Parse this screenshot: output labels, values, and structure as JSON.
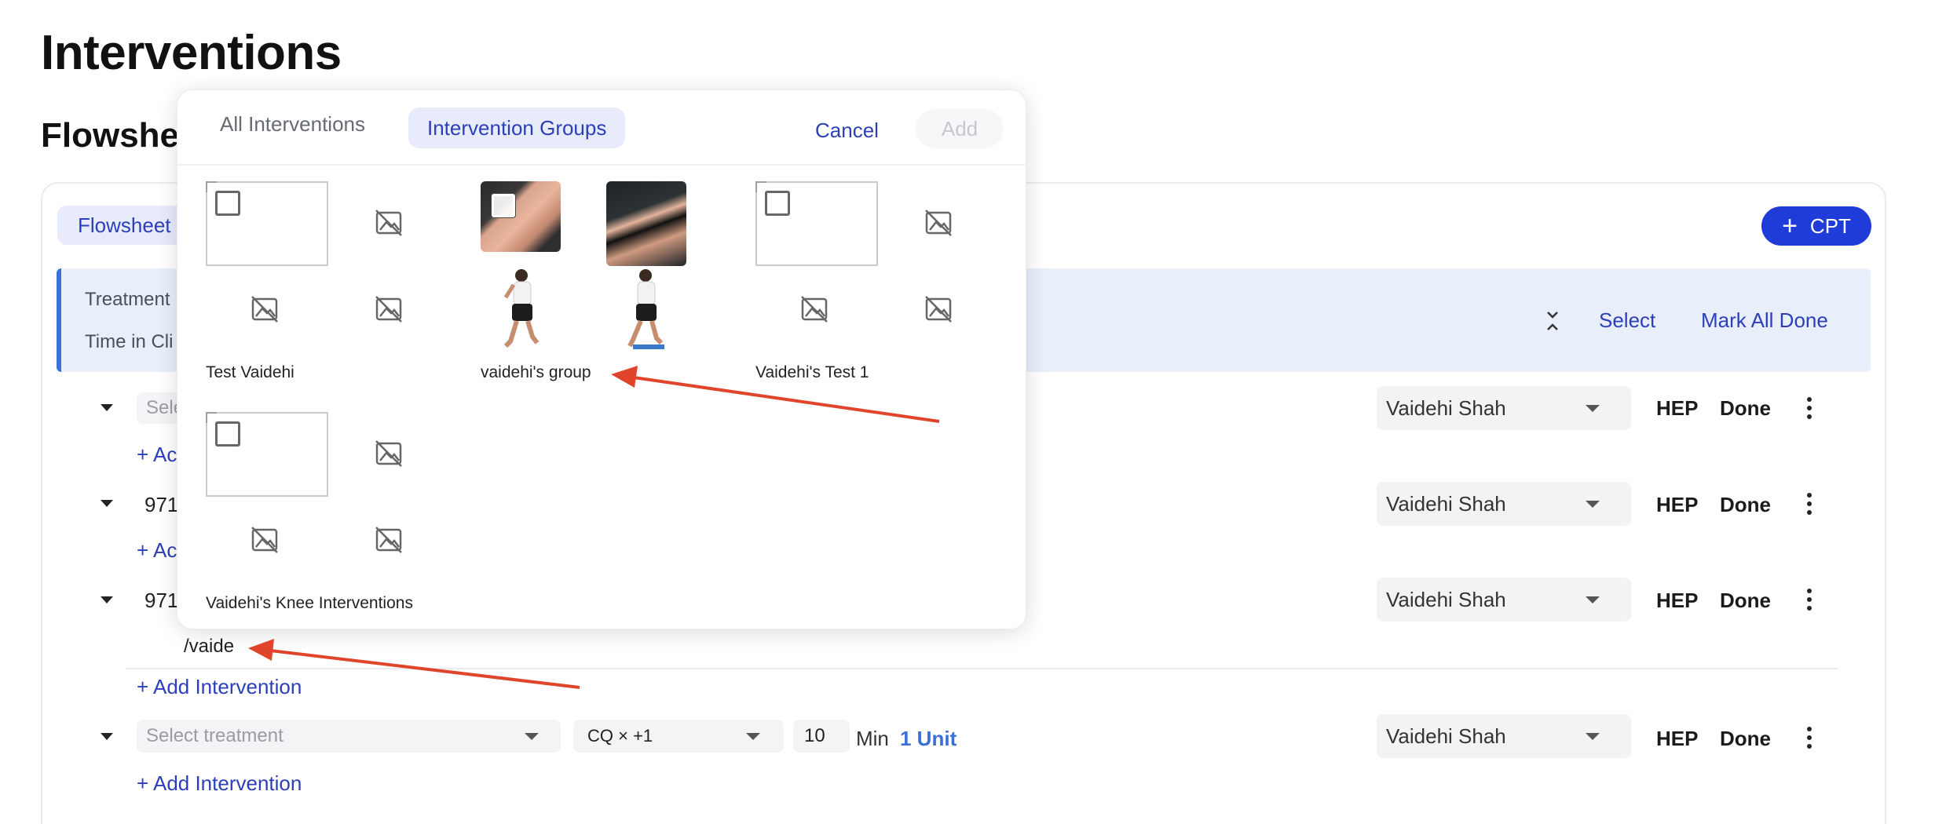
{
  "page": {
    "title": "Interventions",
    "section": "Flowshee"
  },
  "card": {
    "chip_label": "Flowsheet",
    "cpt_button": "CPT",
    "treatment_label": "Treatment",
    "time_label": "Time in Cli",
    "select_label": "Select",
    "mark_all_label": "Mark All Done"
  },
  "rows": [
    {
      "value": "Sele",
      "staff": "Vaidehi Shah",
      "hep": "HEP",
      "done": "Done",
      "add": "+ Ac"
    },
    {
      "value": "971",
      "staff": "Vaidehi Shah",
      "hep": "HEP",
      "done": "Done",
      "add": "+ Ac"
    },
    {
      "value": "971",
      "staff": "Vaidehi Shah",
      "hep": "HEP",
      "done": "Done",
      "add": "+ Add Intervention",
      "typed": "/vaide"
    },
    {
      "value": "Select treatment",
      "staff": "Vaidehi Shah",
      "hep": "HEP",
      "done": "Done",
      "add": "+ Add Intervention",
      "modifier": "CQ × +1",
      "minutes": "10",
      "min_label": "Min",
      "units": "1 Unit"
    }
  ],
  "popover": {
    "tab_all": "All Interventions",
    "tab_groups": "Intervention Groups",
    "cancel": "Cancel",
    "add": "Add",
    "groups": [
      {
        "name": "Test Vaidehi"
      },
      {
        "name": "vaidehi's group"
      },
      {
        "name": "Vaidehi's Test 1"
      },
      {
        "name": "Vaidehi's Knee Interventions"
      }
    ]
  },
  "colors": {
    "accent": "#2c3fb8",
    "cpt": "#1f3bd8",
    "annotation": "#e0452b",
    "unit": "#3b6fd8"
  }
}
